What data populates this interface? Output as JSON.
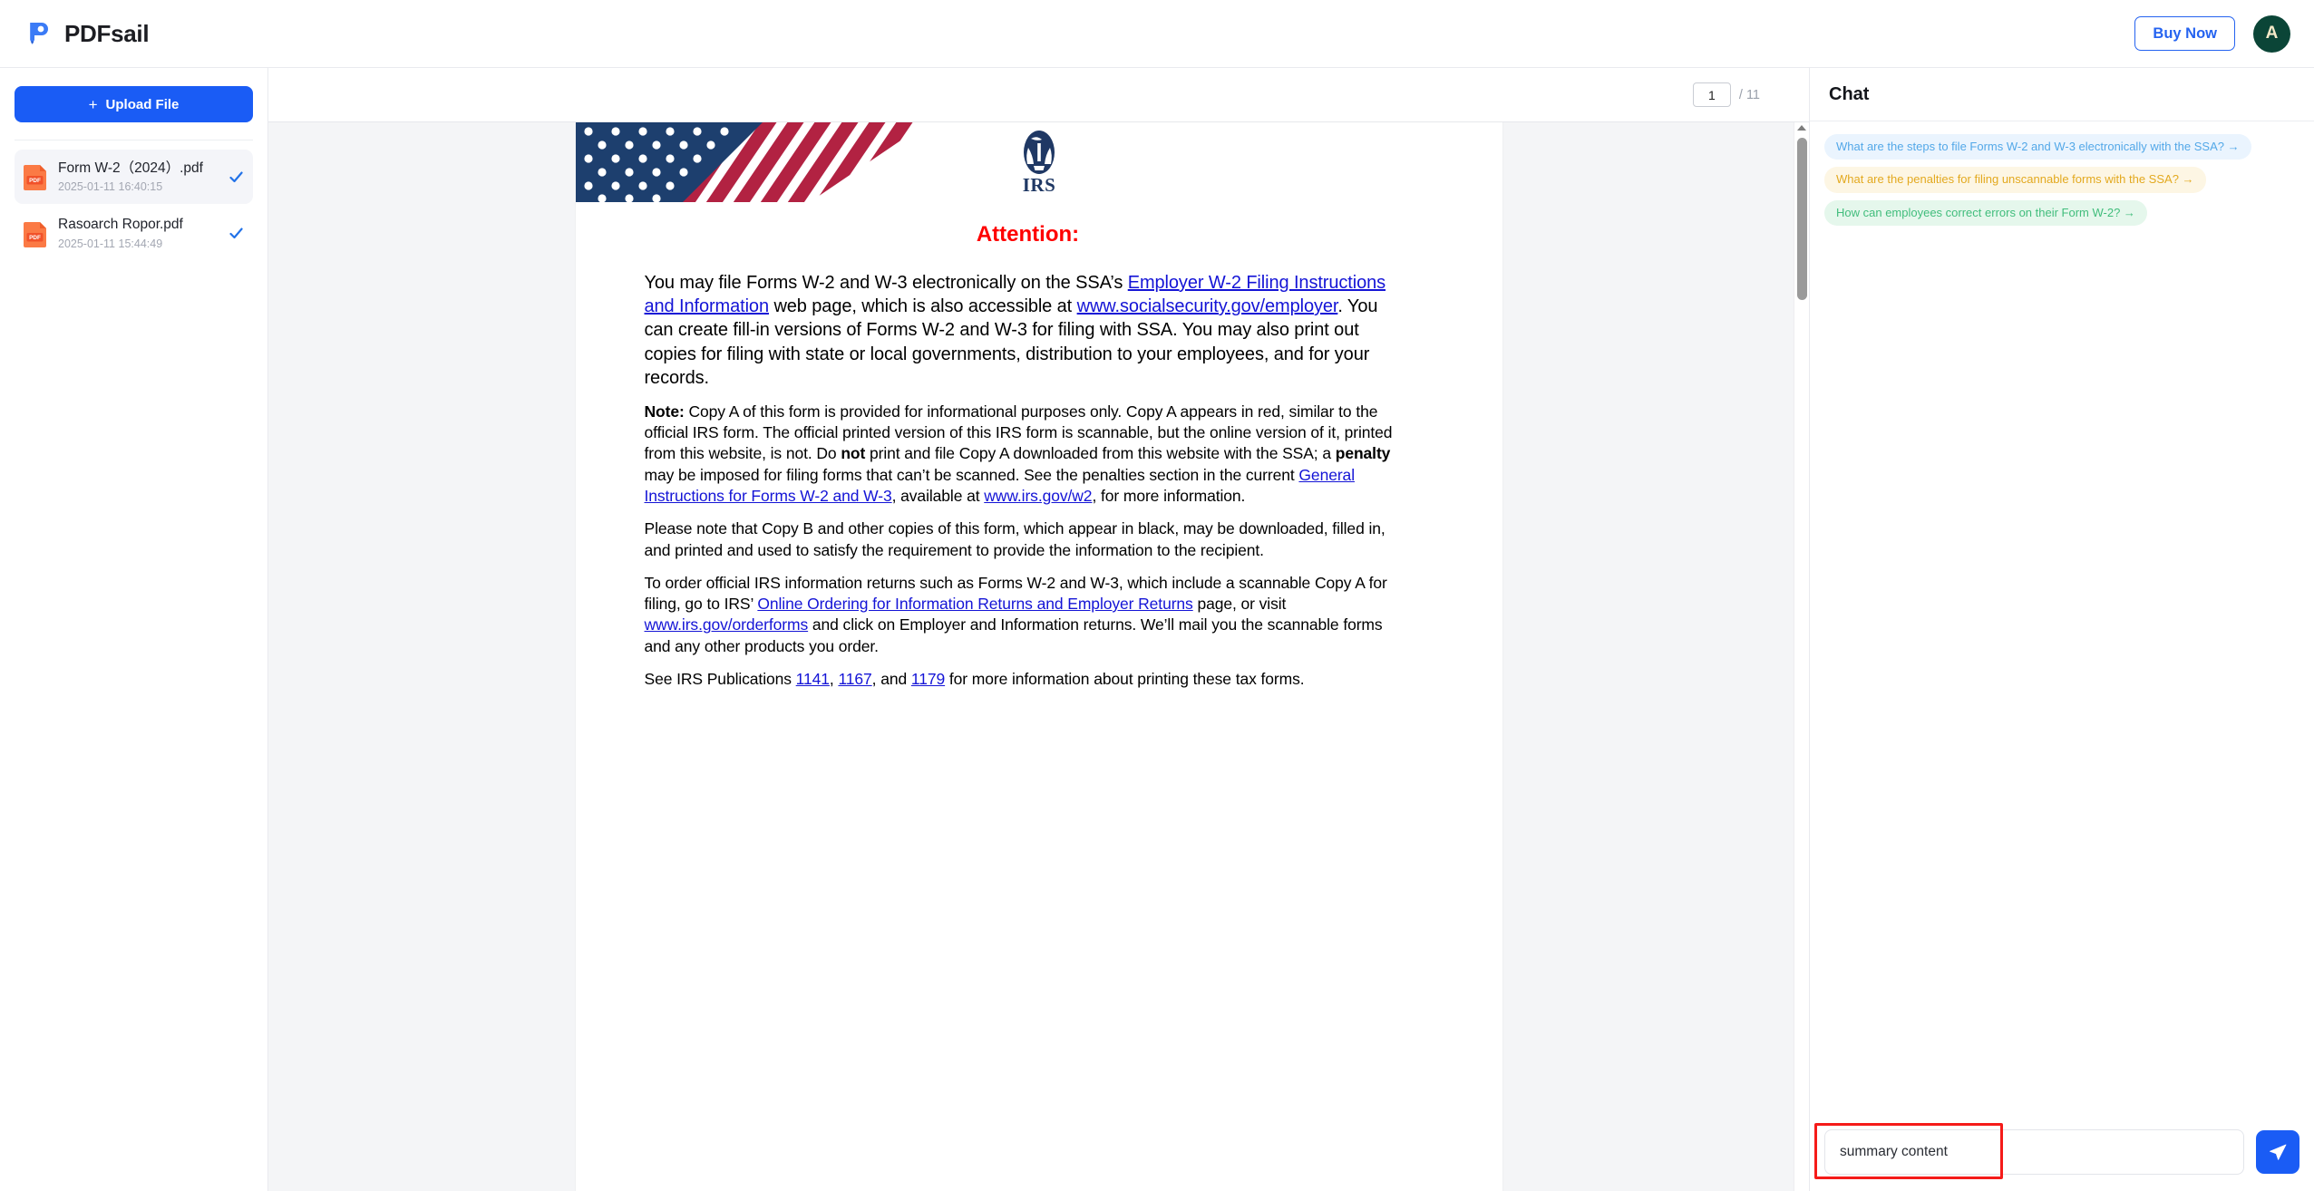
{
  "app": {
    "brand_name": "PDFsail",
    "logo_icon": "pen-p-logo-icon",
    "accent_color": "#1a5cf5",
    "buy_now_label": "Buy Now",
    "avatar_initial": "A"
  },
  "sidebar": {
    "upload_label": "Upload File",
    "upload_plus": "+",
    "files": [
      {
        "name": "Form W-2（2024）.pdf",
        "date": "2025-01-11 16:40:15",
        "icon": "pdf-file-icon",
        "status_icon": "check-icon",
        "selected": true
      },
      {
        "name": "Rasoarch Ropor.pdf",
        "date": "2025-01-11 15:44:49",
        "icon": "pdf-file-icon",
        "status_icon": "check-icon",
        "selected": false
      }
    ]
  },
  "viewer": {
    "current_page": "1",
    "page_separator": "/ 11",
    "scrollbar": "vertical-scrollbar"
  },
  "document": {
    "flag_image": "us-flag-graphic",
    "agency_logo": "irs-eagle-logo",
    "agency_name": "IRS",
    "attention_heading": "Attention:",
    "paragraph_1": {
      "seg1": "You may file Forms W-2 and W-3 electronically on the SSA’s ",
      "link1": "Employer W-2 Filing Instructions and Information",
      "seg2": " web page, which is also accessible at ",
      "link2": "www.socialsecurity.gov/employer",
      "seg3": ".  You can create fill-in versions of Forms W-2 and W-3 for filing with SSA. You may also print out copies for filing with state or local governments, distribution to your employees, and for your records."
    },
    "paragraph_2": {
      "bold1": "Note:",
      "seg1": " Copy A of this form is provided for informational purposes only. Copy A appears in red, similar to the official IRS form. The official printed version of this IRS form is scannable, but the online version of it, printed from this website, is not. Do ",
      "bold2": "not",
      "seg2": " print and file Copy A downloaded from this website with the SSA; a ",
      "bold3": "penalty",
      "seg3": " may be imposed for filing forms that can’t be scanned. See the penalties section in the current ",
      "link1": "General Instructions for Forms W-2 and W-3",
      "seg4": ", available at ",
      "link2": "www.irs.gov/w2",
      "seg5": ", for more information."
    },
    "paragraph_3": "Please note that Copy B and other copies of this form, which appear in black, may be downloaded, filled in, and printed and used to satisfy the requirement to provide the information to the recipient.",
    "paragraph_4": {
      "seg1": "To order official IRS information returns such as Forms W-2 and W-3, which include a scannable Copy A for filing, go to IRS’ ",
      "link1": "Online Ordering for Information Returns and Employer Returns",
      "seg2": " page, or visit ",
      "link2": "www.irs.gov/orderforms",
      "seg3": " and click on Employer and Information returns. We’ll mail you the scannable forms and any other products you order."
    },
    "paragraph_5": {
      "seg1": "See IRS Publications ",
      "link1": "1141",
      "seg2": ", ",
      "link2": "1167",
      "seg3": ", and ",
      "link3": "1179",
      "seg4": " for more information about printing these tax forms."
    }
  },
  "chat": {
    "title": "Chat",
    "suggestions": [
      {
        "text": "What are the steps to file Forms W-2 and W-3 electronically with the SSA? →",
        "color": "#53a8e8",
        "bg": "#eaf4fe"
      },
      {
        "text": "What are the penalties for filing unscannable forms with the SSA? →",
        "color": "#e3a91f",
        "bg": "#fdf6e4"
      },
      {
        "text": "How can employees correct errors on their Form W-2? →",
        "color": "#41bd7c",
        "bg": "#e5f7ec"
      }
    ],
    "input_value": "summary content",
    "input_placeholder": "summary content",
    "send_icon": "send-paper-plane-icon",
    "annotation_color": "#f51b19"
  }
}
